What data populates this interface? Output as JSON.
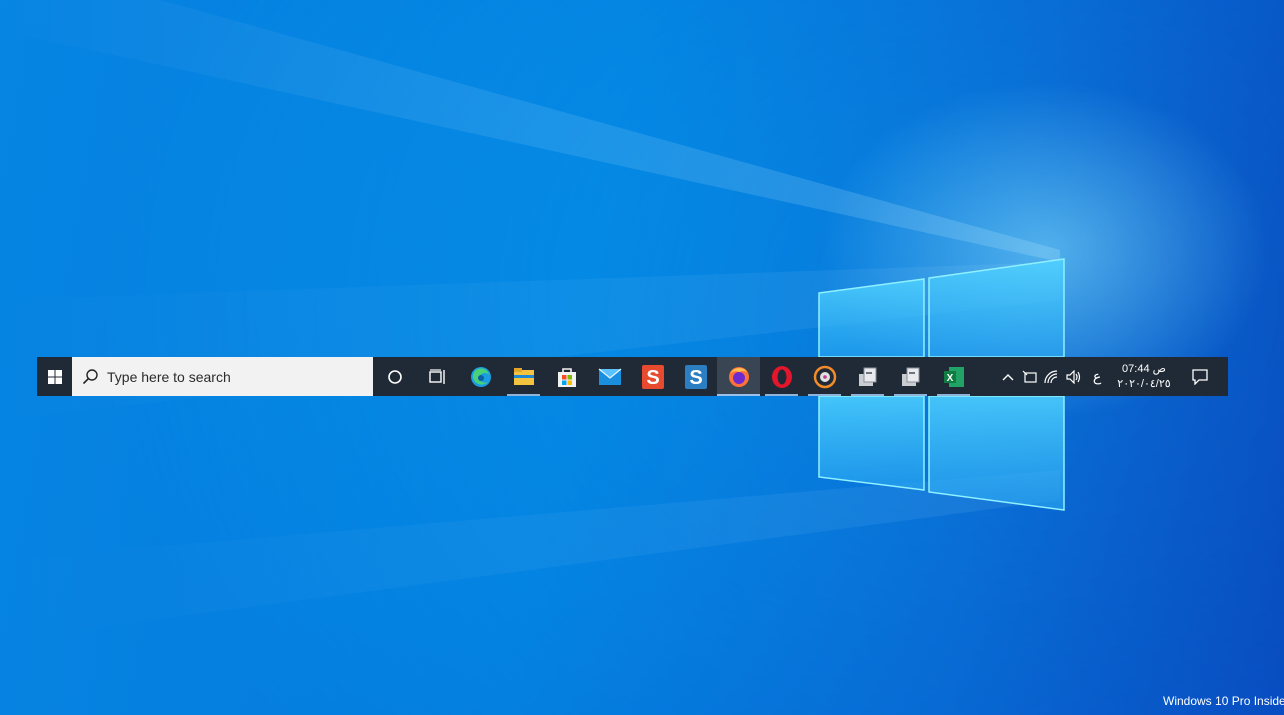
{
  "search": {
    "placeholder": "Type here to search"
  },
  "taskbar": {
    "buttons": [
      {
        "name": "cortana-icon"
      },
      {
        "name": "task-view-icon"
      }
    ],
    "apps": [
      {
        "name": "edge-icon",
        "running": false,
        "active": false
      },
      {
        "name": "file-explorer-icon",
        "running": true,
        "active": false
      },
      {
        "name": "microsoft-store-icon",
        "running": false,
        "active": false
      },
      {
        "name": "mail-icon",
        "running": false,
        "active": false
      },
      {
        "name": "app-s-red-icon",
        "running": false,
        "active": false
      },
      {
        "name": "app-s-blue-icon",
        "running": false,
        "active": false
      },
      {
        "name": "firefox-icon",
        "running": true,
        "active": true
      },
      {
        "name": "opera-icon",
        "running": true,
        "active": false
      },
      {
        "name": "media-player-icon",
        "running": true,
        "active": false
      },
      {
        "name": "installer-icon",
        "running": true,
        "active": false
      },
      {
        "name": "installer-icon",
        "running": true,
        "active": false
      },
      {
        "name": "excel-icon",
        "running": true,
        "active": false
      }
    ]
  },
  "tray": {
    "language": "ع",
    "time": "07:44 ص",
    "date": "٢٠٢٠/٠٤/٢٥"
  },
  "watermark": {
    "text": "Windows 10 Pro Insider"
  },
  "colors": {
    "taskbar": "#202a36",
    "search_box": "#f2f2f2",
    "wallpaper_blue": "#0596ea"
  }
}
